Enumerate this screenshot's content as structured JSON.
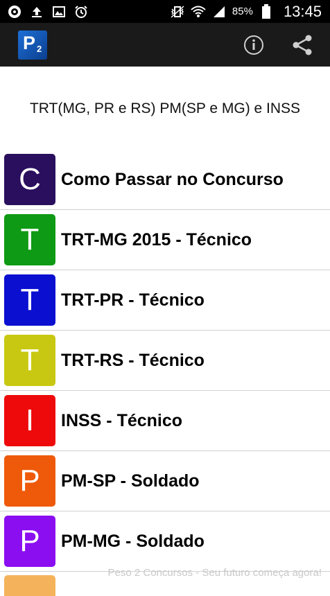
{
  "status_bar": {
    "battery_percent": "85%",
    "time": "13:45",
    "icons": [
      "app-icon",
      "upload-icon",
      "image-icon",
      "alarm-icon",
      "vibrate-icon",
      "wifi-icon",
      "signal-icon",
      "battery-icon"
    ]
  },
  "app_bar": {
    "logo_text": "P",
    "logo_subscript": "2",
    "actions": [
      "info-icon",
      "share-icon"
    ]
  },
  "heading": "TRT(MG, PR e RS) PM(SP e MG) e INSS",
  "items": [
    {
      "letter": "C",
      "label": "Como Passar no Concurso",
      "color": "#2a0f5e"
    },
    {
      "letter": "T",
      "label": "TRT-MG 2015 - Técnico",
      "color": "#0e9a14"
    },
    {
      "letter": "T",
      "label": "TRT-PR - Técnico",
      "color": "#0b0fd0"
    },
    {
      "letter": "T",
      "label": "TRT-RS - Técnico",
      "color": "#c8c812"
    },
    {
      "letter": "I",
      "label": "INSS - Técnico",
      "color": "#ee0a0a"
    },
    {
      "letter": "P",
      "label": "PM-SP - Soldado",
      "color": "#ee5a0a"
    },
    {
      "letter": "P",
      "label": "PM-MG - Soldado",
      "color": "#8a0ef0"
    }
  ],
  "peek_item_color": "#f4b35a",
  "footer": "Peso 2 Concursos - Seu futuro começa agora!"
}
